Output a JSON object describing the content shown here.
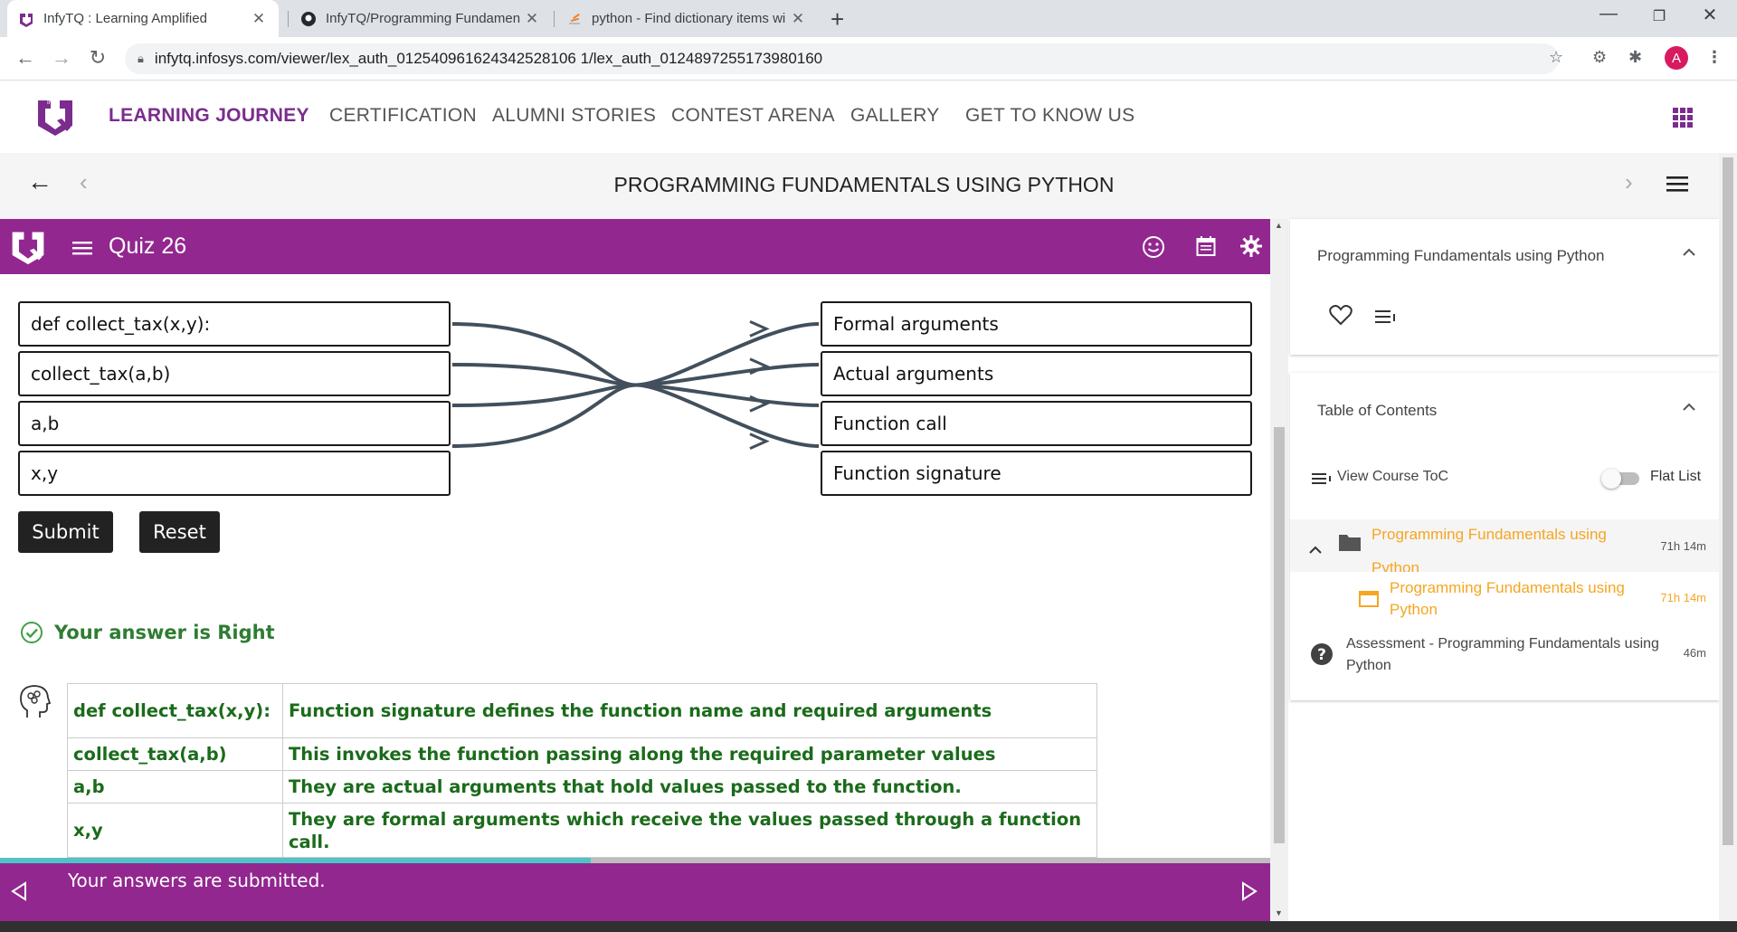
{
  "browser": {
    "tabs": [
      {
        "title": "InfyTQ : Learning Amplified",
        "active": true
      },
      {
        "title": "InfyTQ/Programming Fundamen",
        "active": false
      },
      {
        "title": "python - Find dictionary items wi",
        "active": false
      }
    ],
    "url": "infytq.infosys.com/viewer/lex_auth_012540961624342528106 1/lex_auth_0124897255173980160",
    "avatar_letter": "A"
  },
  "site_nav": {
    "items": [
      "LEARNING JOURNEY",
      "CERTIFICATION",
      "ALUMNI STORIES",
      "CONTEST ARENA",
      "GALLERY",
      "GET TO KNOW US"
    ]
  },
  "course": {
    "title": "PROGRAMMING FUNDAMENTALS USING PYTHON"
  },
  "quiz": {
    "title": "Quiz 26",
    "left_items": [
      "def collect_tax(x,y):",
      "collect_tax(a,b)",
      "a,b",
      "x,y"
    ],
    "right_items": [
      "Formal arguments",
      "Actual arguments",
      "Function call",
      "Function signature"
    ],
    "connections": [
      [
        0,
        3
      ],
      [
        1,
        2
      ],
      [
        2,
        1
      ],
      [
        3,
        0
      ]
    ],
    "submit_label": "Submit",
    "reset_label": "Reset",
    "result_text": "Your answer is Right",
    "explanations": [
      {
        "term": "def collect_tax(x,y):",
        "desc": "Function signature defines the function name and required arguments"
      },
      {
        "term": "collect_tax(a,b)",
        "desc": "This invokes the function passing along the required parameter values"
      },
      {
        "term": "a,b",
        "desc": "They are actual arguments that hold values passed to the function."
      },
      {
        "term": "x,y",
        "desc": "They are formal arguments which receive the values passed through a function call."
      }
    ],
    "footer_message": "Your answers are submitted.",
    "progress_fraction": 0.465
  },
  "sidebar": {
    "course_card_title": "Programming Fundamentals using Python",
    "toc_title": "Table of Contents",
    "view_toc_label": "View Course ToC",
    "flat_list_label": "Flat List",
    "toc_items": [
      {
        "label": "Programming Fundamentals using Python",
        "duration": "71h 14m"
      },
      {
        "label": "Programming Fundamentals using Python",
        "duration": "71h 14m"
      },
      {
        "label": "Assessment - Programming Fundamentals using Python",
        "duration": "46m"
      }
    ]
  },
  "colors": {
    "brand_purple": "#92278f",
    "nav_active": "#7b2c8e",
    "answer_green": "#1b6b1b",
    "toc_orange": "#f5a623",
    "progress_teal": "#4fc3c6"
  }
}
